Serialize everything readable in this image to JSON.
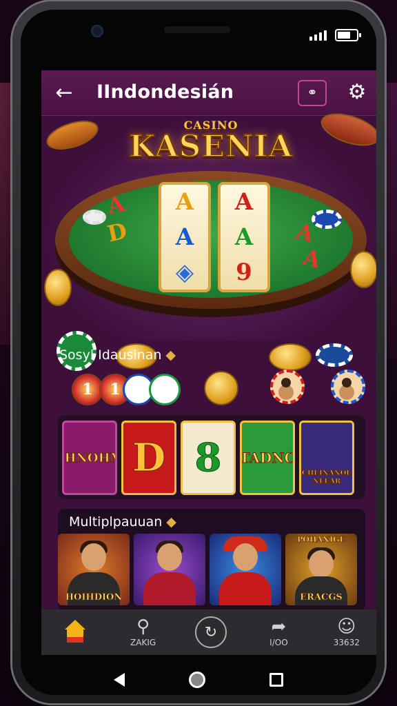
{
  "appbar": {
    "title": "IIndondesián",
    "back_icon": "arrow-left-icon",
    "action_icon": "link-icon",
    "settings_icon": "gear-icon"
  },
  "status": {
    "battery_level": 0.7,
    "signal_bars": 4
  },
  "hero": {
    "logo_small": "CASINO",
    "logo_big": "KASENIA",
    "reel1": [
      "A",
      "A",
      "◈"
    ],
    "reel2": [
      "A",
      "A",
      "9"
    ],
    "left_symbols": [
      "A",
      "D"
    ],
    "right_symbols": [
      "A",
      "A"
    ]
  },
  "section1": {
    "title": "Sosyl Idausinan",
    "tokens": [
      "1",
      "1"
    ]
  },
  "section2": {
    "cards": [
      {
        "label": "SHNOHM",
        "bg": "#8a1a6a"
      },
      {
        "label": "D",
        "bg": "#c81a1a"
      },
      {
        "label": "8",
        "bg": "#f4ead0"
      },
      {
        "label": "TADNC",
        "bg": "#2a9a3a"
      },
      {
        "label": "CHEINANOE NEEAR",
        "bg": "#3a2a7a"
      }
    ]
  },
  "section3": {
    "title": "Multiplpauuan",
    "cards": [
      {
        "label": "HOIHDION",
        "bg": "#7a2a1a"
      },
      {
        "label": "",
        "bg": "#5a2a8a"
      },
      {
        "label": "",
        "bg": "#1a4a9a"
      },
      {
        "label": "ERACGS",
        "bg": "#6a3a10",
        "top_label": "POHANIGE"
      }
    ]
  },
  "bottom_nav": {
    "items": [
      {
        "label": "",
        "icon": "home-icon"
      },
      {
        "label": "ZAKIG",
        "icon": "search-icon"
      },
      {
        "label": "",
        "icon": "spin-icon"
      },
      {
        "label": "I/OO",
        "icon": "pin-icon"
      },
      {
        "label": "33632",
        "icon": "profile-icon"
      }
    ]
  },
  "colors": {
    "accent": "#f2b318",
    "screen_bg": "#3d0f3a",
    "appbar_bg": "#4a1244"
  }
}
